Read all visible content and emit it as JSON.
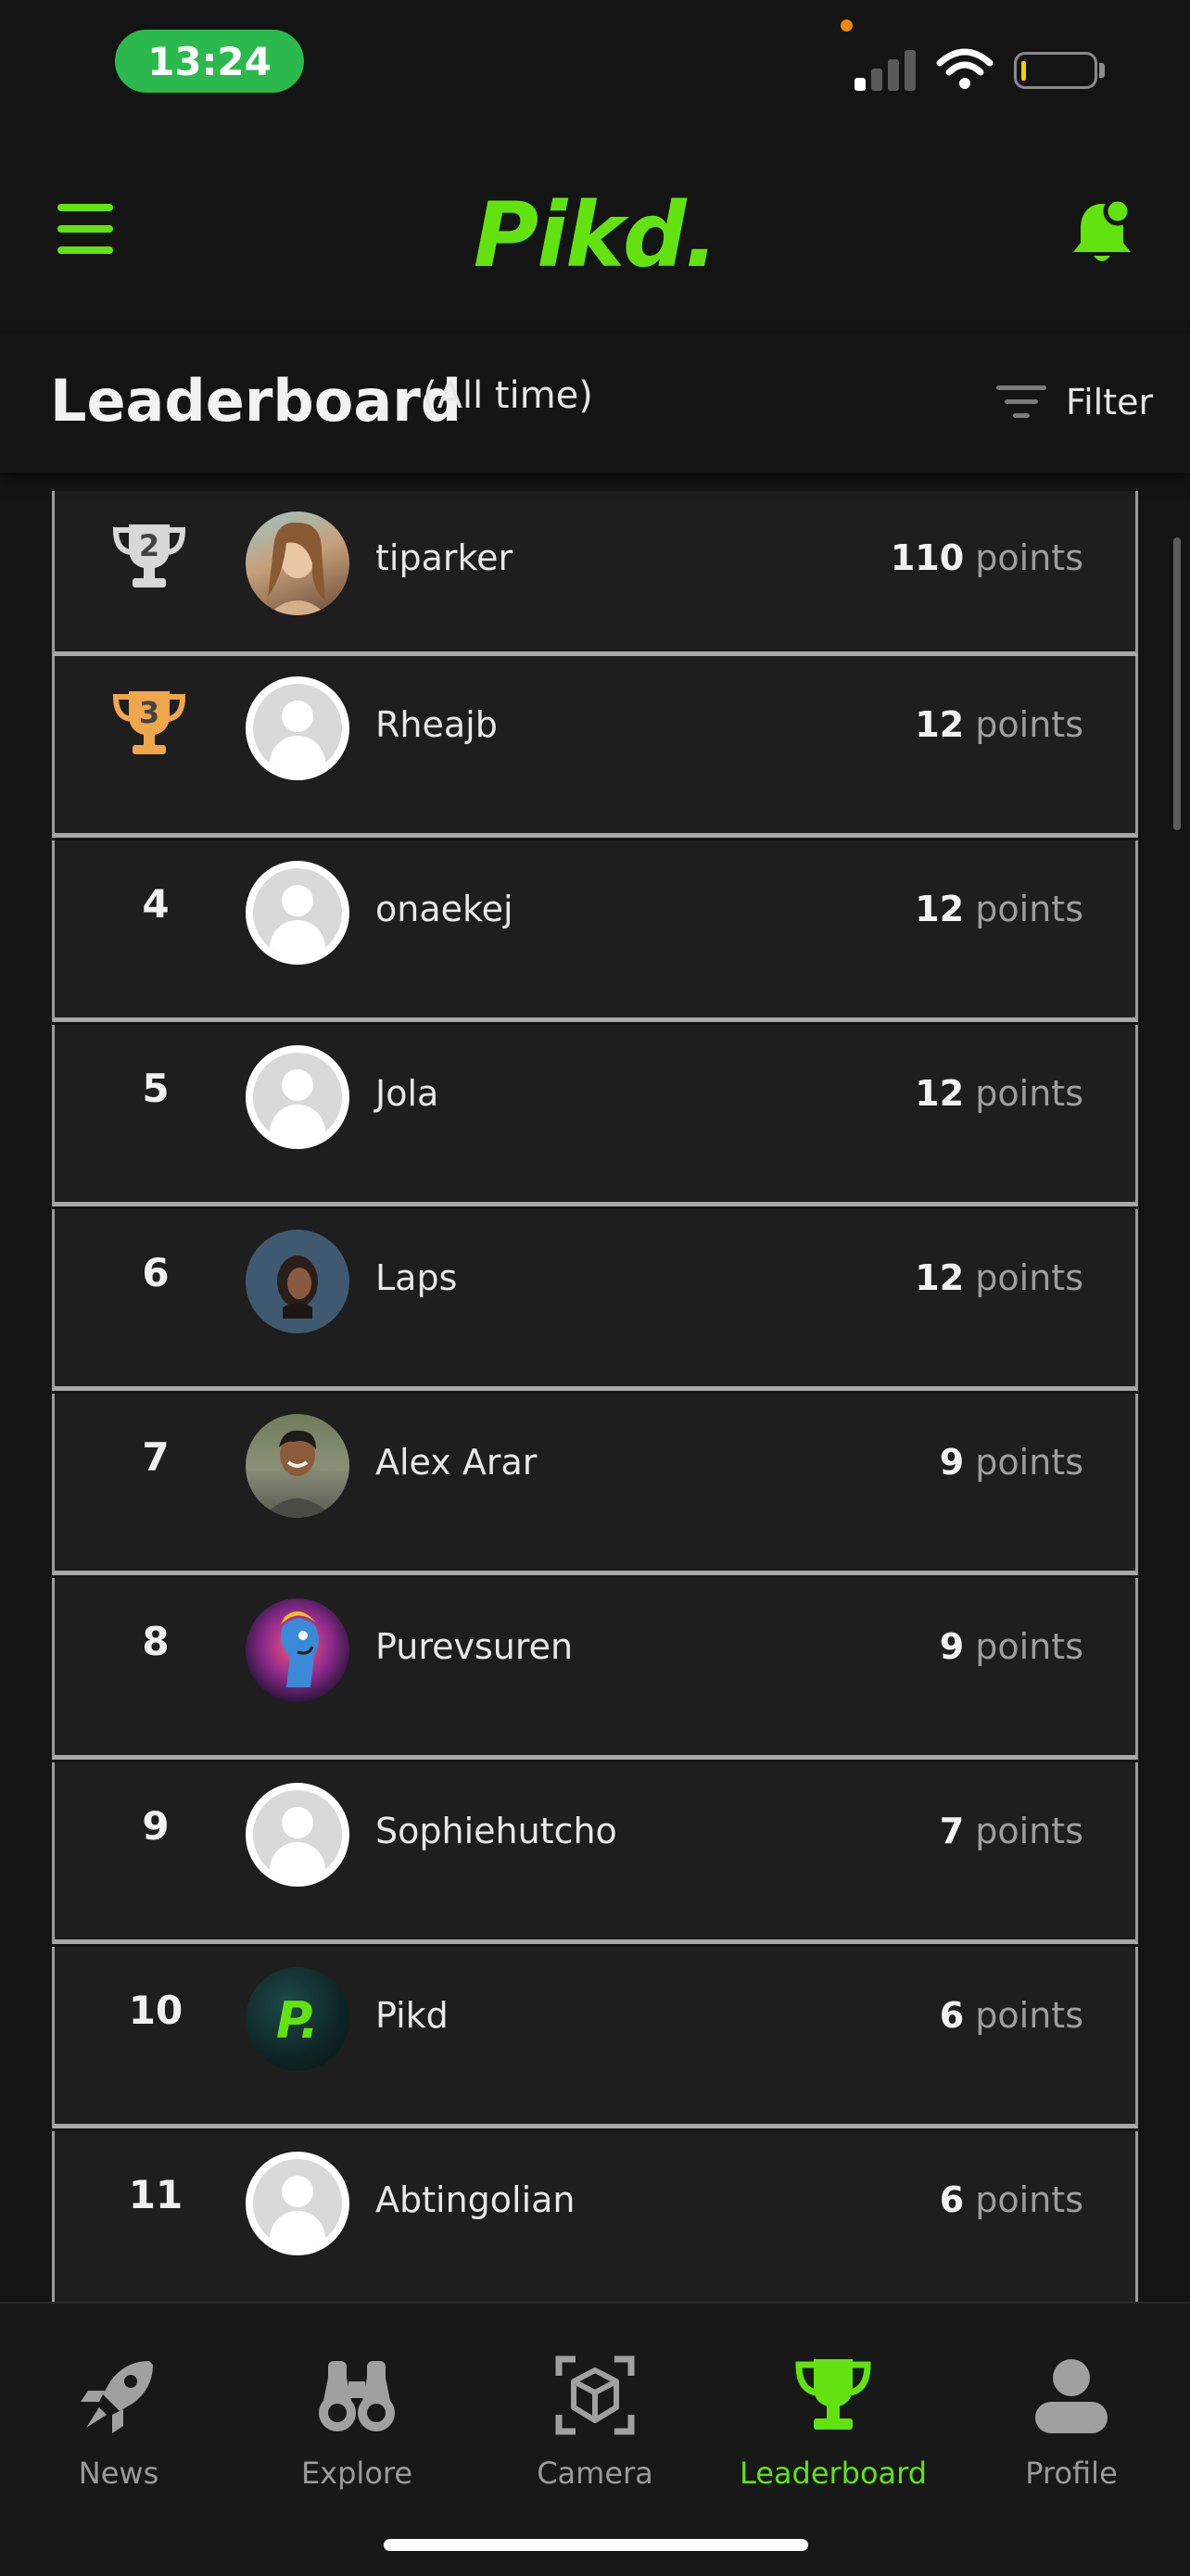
{
  "status": {
    "time": "13:24"
  },
  "header": {
    "logo": "Pikd."
  },
  "section": {
    "title": "Leaderboard",
    "subtitle": "(All time)",
    "filter_label": "Filter"
  },
  "colors": {
    "accent": "#62e30f",
    "background": "#141414",
    "row": "#1e1e1e",
    "silver": "#d8d8d8",
    "bronze": "#f0a64a"
  },
  "leaderboard": [
    {
      "rank": "2",
      "name": "tiparker",
      "points": "110",
      "unit": "points",
      "badge": "silver-trophy",
      "avatar": "photo"
    },
    {
      "rank": "3",
      "name": "Rheajb",
      "points": "12",
      "unit": "points",
      "badge": "bronze-trophy",
      "avatar": "default"
    },
    {
      "rank": "4",
      "name": "onaekej",
      "points": "12",
      "unit": "points",
      "avatar": "default"
    },
    {
      "rank": "5",
      "name": "Jola",
      "points": "12",
      "unit": "points",
      "avatar": "default"
    },
    {
      "rank": "6",
      "name": "Laps",
      "points": "12",
      "unit": "points",
      "avatar": "photo"
    },
    {
      "rank": "7",
      "name": "Alex Arar",
      "points": "9",
      "unit": "points",
      "avatar": "photo"
    },
    {
      "rank": "8",
      "name": "Purevsuren",
      "points": "9",
      "unit": "points",
      "avatar": "photo"
    },
    {
      "rank": "9",
      "name": "Sophiehutcho",
      "points": "7",
      "unit": "points",
      "avatar": "default"
    },
    {
      "rank": "10",
      "name": "Pikd",
      "points": "6",
      "unit": "points",
      "avatar": "logo",
      "avatar_text": "P."
    },
    {
      "rank": "11",
      "name": "Abtingolian",
      "points": "6",
      "unit": "points",
      "avatar": "default"
    }
  ],
  "tabs": [
    {
      "label": "News",
      "icon": "rocket-icon"
    },
    {
      "label": "Explore",
      "icon": "binoculars-icon"
    },
    {
      "label": "Camera",
      "icon": "ar-cube-icon"
    },
    {
      "label": "Leaderboard",
      "icon": "trophy-icon",
      "active": true
    },
    {
      "label": "Profile",
      "icon": "person-icon"
    }
  ]
}
